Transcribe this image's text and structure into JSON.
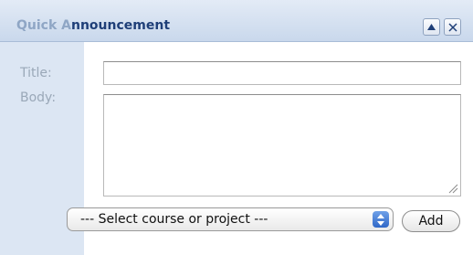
{
  "panel": {
    "title_faded": "Quick A",
    "title_main": "nnouncement",
    "collapse_icon": "triangle-up-icon",
    "close_icon": "close-icon"
  },
  "form": {
    "title_label": "Title:",
    "title_value": "",
    "body_label": "Body:",
    "body_value": "",
    "select_value": "--- Select course or project ---",
    "add_label": "Add"
  },
  "colors": {
    "header_bg": "#c9d8ec",
    "side_strip": "#dce6f3",
    "title_text": "#1f3f78",
    "label_text": "#9aa8b8",
    "select_arrows": "#2f67c7"
  }
}
